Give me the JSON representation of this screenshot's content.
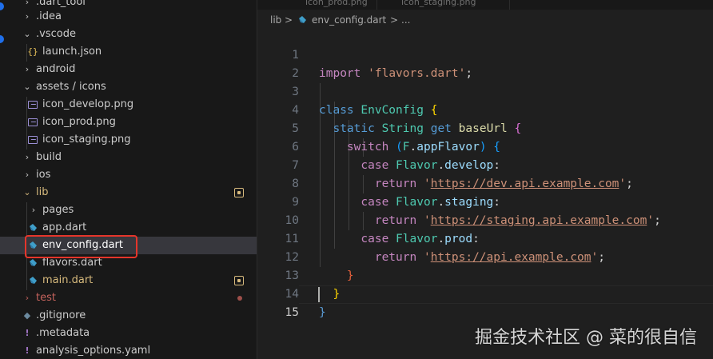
{
  "explorer": {
    "items": [
      {
        "label": ".dart_tool",
        "kind": "folder",
        "expanded": false,
        "depth": 0
      },
      {
        "label": ".idea",
        "kind": "folder",
        "expanded": false,
        "depth": 0
      },
      {
        "label": ".vscode",
        "kind": "folder",
        "expanded": true,
        "depth": 0
      },
      {
        "label": "launch.json",
        "kind": "json",
        "depth": 1
      },
      {
        "label": "android",
        "kind": "folder",
        "expanded": false,
        "depth": 0
      },
      {
        "label": "assets / icons",
        "kind": "folder",
        "expanded": true,
        "depth": 0
      },
      {
        "label": "icon_develop.png",
        "kind": "image",
        "depth": 1
      },
      {
        "label": "icon_prod.png",
        "kind": "image",
        "depth": 1
      },
      {
        "label": "icon_staging.png",
        "kind": "image",
        "depth": 1
      },
      {
        "label": "build",
        "kind": "folder",
        "expanded": false,
        "depth": 0
      },
      {
        "label": "ios",
        "kind": "folder",
        "expanded": false,
        "depth": 0
      },
      {
        "label": "lib",
        "kind": "folder",
        "expanded": true,
        "depth": 0,
        "status": "modified"
      },
      {
        "label": "pages",
        "kind": "folder",
        "expanded": false,
        "depth": 1
      },
      {
        "label": "app.dart",
        "kind": "dart",
        "depth": 1
      },
      {
        "label": "env_config.dart",
        "kind": "dart",
        "depth": 1,
        "selected": true
      },
      {
        "label": "flavors.dart",
        "kind": "dart",
        "depth": 1
      },
      {
        "label": "main.dart",
        "kind": "dart",
        "depth": 1,
        "status": "modified"
      },
      {
        "label": "test",
        "kind": "folder",
        "expanded": false,
        "depth": 0,
        "status": "error-dot"
      },
      {
        "label": ".gitignore",
        "kind": "git",
        "depth": 0
      },
      {
        "label": ".metadata",
        "kind": "meta",
        "depth": 0
      },
      {
        "label": "analysis_options.yaml",
        "kind": "yaml",
        "depth": 0
      }
    ]
  },
  "editor": {
    "tabs": [
      "icon_prod.png",
      "icon_staging.png"
    ],
    "breadcrumb": {
      "folder": "lib",
      "sep": ">",
      "file": "env_config.dart",
      "more": "..."
    },
    "active_line": 15,
    "lines": [
      {
        "n": "1",
        "code": "import 'flavors.dart';"
      },
      {
        "n": "2",
        "code": ""
      },
      {
        "n": "3",
        "code": "class EnvConfig {"
      },
      {
        "n": "4",
        "code": "  static String get baseUrl {"
      },
      {
        "n": "5",
        "code": "    switch (F.appFlavor) {"
      },
      {
        "n": "6",
        "code": "      case Flavor.develop:"
      },
      {
        "n": "7",
        "code": "        return 'https://dev.api.example.com';"
      },
      {
        "n": "8",
        "code": "      case Flavor.staging:"
      },
      {
        "n": "9",
        "code": "        return 'https://staging.api.example.com';"
      },
      {
        "n": "10",
        "code": "      case Flavor.prod:"
      },
      {
        "n": "11",
        "code": "        return 'https://api.example.com';"
      },
      {
        "n": "12",
        "code": "    }"
      },
      {
        "n": "13",
        "code": "  }"
      },
      {
        "n": "14",
        "code": "}"
      },
      {
        "n": "15",
        "code": ""
      }
    ]
  },
  "watermark": "掘金技术社区 @ 菜的很自信",
  "colors": {
    "keyword": "#569cd6",
    "control": "#c586c0",
    "type": "#4ec9b0",
    "string": "#ce9178",
    "modified": "#d7ba7d",
    "highlight_box": "#e5352b"
  }
}
